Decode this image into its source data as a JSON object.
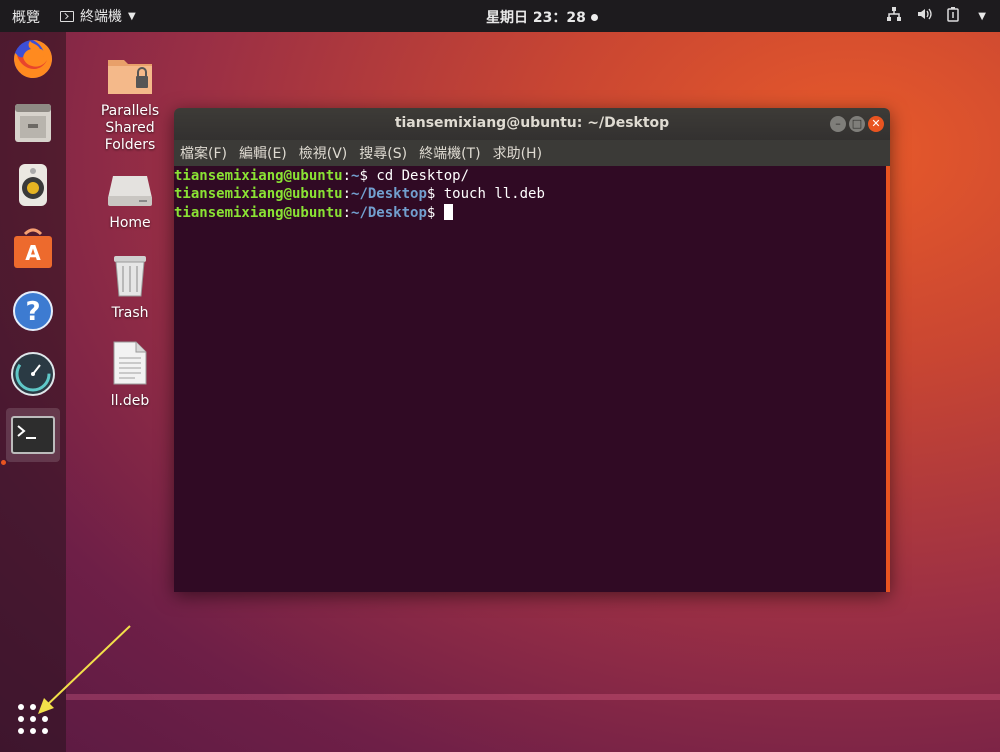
{
  "topbar": {
    "activities": "概覽",
    "app_menu": "終端機",
    "clock": "星期日 23：28",
    "tray_icons": [
      "network-icon",
      "volume-icon",
      "battery-icon",
      "menu-arrow-icon"
    ]
  },
  "dock": {
    "items": [
      "firefox-icon",
      "files-icon",
      "rhythmbox-icon",
      "software-icon",
      "help-icon",
      "stacer-icon",
      "terminal-icon"
    ],
    "apps_grid": "apps-grid-icon"
  },
  "desktop": {
    "icons": [
      {
        "label": "Parallels\nShared\nFolders",
        "icon": "shared-folder-icon"
      },
      {
        "label": "Home",
        "icon": "home-drive-icon"
      },
      {
        "label": "Trash",
        "icon": "trash-icon"
      },
      {
        "label": "ll.deb",
        "icon": "file-icon"
      }
    ]
  },
  "terminal": {
    "title": "tiansemixiang@ubuntu: ~/Desktop",
    "menu": [
      "檔案(F)",
      "編輯(E)",
      "檢視(V)",
      "搜尋(S)",
      "終端機(T)",
      "求助(H)"
    ],
    "lines": [
      {
        "user": "tiansemixiang@ubuntu",
        "path": "~",
        "cmd": " cd Desktop/"
      },
      {
        "user": "tiansemixiang@ubuntu",
        "path": "~/Desktop",
        "cmd": " touch ll.deb"
      },
      {
        "user": "tiansemixiang@ubuntu",
        "path": "~/Desktop",
        "cmd": " "
      }
    ]
  },
  "colors": {
    "accent": "#e95420",
    "terminal_bg": "#300a24",
    "prompt_user": "#8ae234",
    "prompt_path": "#729fcf",
    "arrow": "#f2e04a"
  }
}
